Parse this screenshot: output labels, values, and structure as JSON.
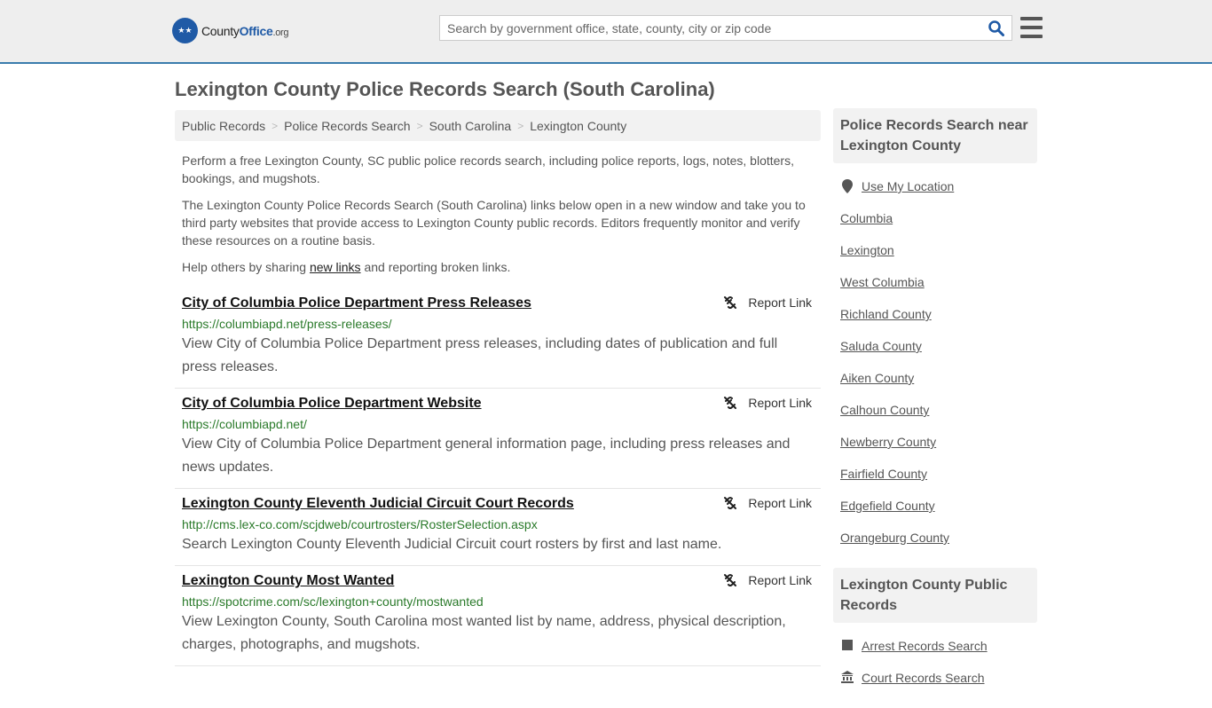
{
  "header": {
    "logo": {
      "part1": "County",
      "part2": "Office",
      "part3": ".org"
    },
    "search_placeholder": "Search by government office, state, county, city or zip code",
    "search_icon": "search-icon",
    "menu_icon": "hamburger-menu-icon"
  },
  "page_title": "Lexington County Police Records Search (South Carolina)",
  "breadcrumb": [
    "Public Records",
    "Police Records Search",
    "South Carolina",
    "Lexington County"
  ],
  "intro": {
    "p1": "Perform a free Lexington County, SC public police records search, including police reports, logs, notes, blotters, bookings, and mugshots.",
    "p2": "The Lexington County Police Records Search (South Carolina) links below open in a new window and take you to third party websites that provide access to Lexington County public records. Editors frequently monitor and verify these resources on a routine basis.",
    "p3_before": "Help others by sharing ",
    "p3_link": "new links",
    "p3_after": " and reporting broken links."
  },
  "report_label": "Report Link",
  "results": [
    {
      "title": "City of Columbia Police Department Press Releases",
      "url": "https://columbiapd.net/press-releases/",
      "desc": "View City of Columbia Police Department press releases, including dates of publication and full press releases."
    },
    {
      "title": "City of Columbia Police Department Website",
      "url": "https://columbiapd.net/",
      "desc": "View City of Columbia Police Department general information page, including press releases and news updates."
    },
    {
      "title": "Lexington County Eleventh Judicial Circuit Court Records",
      "url": "http://cms.lex-co.com/scjdweb/courtrosters/RosterSelection.aspx",
      "desc": "Search Lexington County Eleventh Judicial Circuit court rosters by first and last name."
    },
    {
      "title": "Lexington County Most Wanted",
      "url": "https://spotcrime.com/sc/lexington+county/mostwanted",
      "desc": "View Lexington County, South Carolina most wanted list by name, address, physical description, charges, photographs, and mugshots."
    }
  ],
  "sidebar": {
    "nearby_heading": "Police Records Search near Lexington County",
    "use_location": "Use My Location",
    "nearby": [
      "Columbia",
      "Lexington",
      "West Columbia",
      "Richland County",
      "Saluda County",
      "Aiken County",
      "Calhoun County",
      "Newberry County",
      "Fairfield County",
      "Edgefield County",
      "Orangeburg County"
    ],
    "public_heading": "Lexington County Public Records",
    "public_links": [
      "Arrest Records Search",
      "Court Records Search"
    ]
  }
}
